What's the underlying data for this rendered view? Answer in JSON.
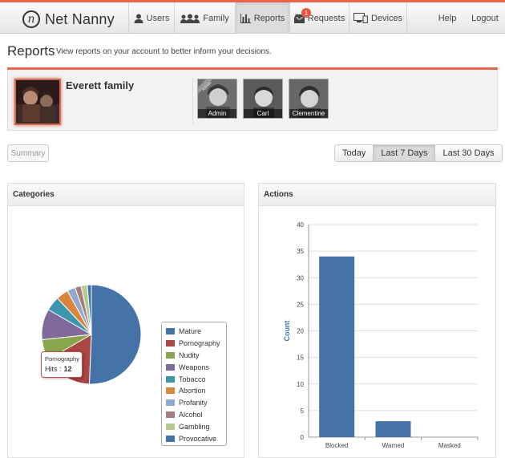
{
  "app": {
    "name": "Net Nanny",
    "logo_mark": "n"
  },
  "nav": {
    "items": [
      {
        "label": "Users",
        "icon": "user-icon"
      },
      {
        "label": "Family",
        "icon": "family-icon"
      },
      {
        "label": "Reports",
        "icon": "bar-chart-icon",
        "active": true
      },
      {
        "label": "Requests",
        "icon": "inbox-icon",
        "badge": "1"
      },
      {
        "label": "Devices",
        "icon": "devices-icon"
      }
    ],
    "help": "Help",
    "logout": "Logout"
  },
  "header": {
    "title": "Reports",
    "subtitle": "View reports on your account to better inform your decisions."
  },
  "family": {
    "name": "Everett family",
    "members": [
      {
        "name": "Admin",
        "ribbon": "Admin"
      },
      {
        "name": "Carl"
      },
      {
        "name": "Clementine"
      }
    ]
  },
  "filters": {
    "summary": "Summary",
    "ranges": [
      "Today",
      "Last 7 Days",
      "Last 30 Days"
    ],
    "active_range": "Last 7 Days"
  },
  "categories_panel": {
    "title": "Categories",
    "tooltip": {
      "category": "Pornography",
      "hits_label": "Hits :",
      "hits_value": "12"
    }
  },
  "actions_panel": {
    "title": "Actions"
  },
  "chart_data": [
    {
      "type": "pie",
      "categories": [
        "Mature",
        "Pornography",
        "Nudity",
        "Weapons",
        "Tobacco",
        "Abortion",
        "Profanity",
        "Alcohol",
        "Gambling",
        "Provocative"
      ],
      "values": [
        38,
        12,
        5,
        7.5,
        3.5,
        3,
        2,
        1.5,
        1.5,
        1
      ],
      "colors": [
        "#4572a7",
        "#aa4643",
        "#89a54e",
        "#80699b",
        "#3d96ae",
        "#db843d",
        "#92a8cd",
        "#a47d7c",
        "#b5ca92",
        "#4572a7"
      ],
      "legend": "right"
    },
    {
      "type": "bar",
      "categories": [
        "Blocked",
        "Warned",
        "Masked"
      ],
      "values": [
        34,
        3,
        0
      ],
      "ylabel": "Count",
      "ylim": [
        0,
        40
      ],
      "yticks": [
        0,
        5,
        10,
        15,
        20,
        25,
        30,
        35,
        40
      ],
      "color": "#4572a7",
      "grid": true
    }
  ]
}
